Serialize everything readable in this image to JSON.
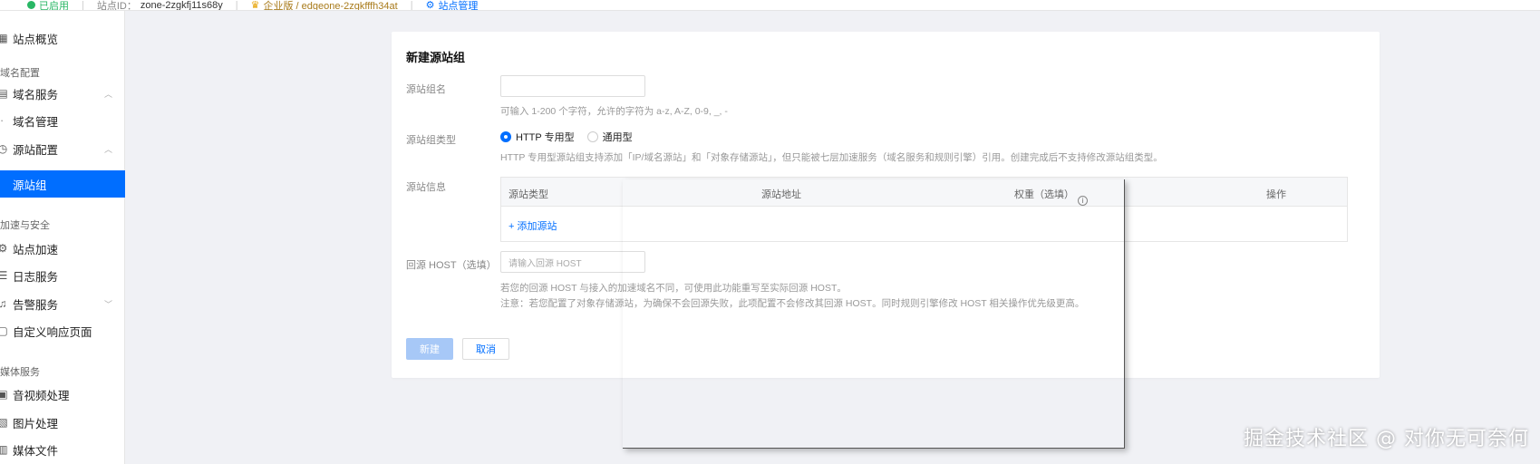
{
  "topbar": {
    "status": "已启用",
    "site_id_label": "站点ID：",
    "site_id": "zone-2zgkfj11s68y",
    "plan": "企业版 / edgeone-2zgkfffh34at",
    "manage": "站点管理",
    "colors": {
      "status": "#29b765",
      "link": "#006eff"
    }
  },
  "sidebar": {
    "overview": "站点概览",
    "group_config": "域名配置",
    "domain_service": "域名服务",
    "domain_manage": "域名管理",
    "origin_config": "源站配置",
    "origin_group": "源站组",
    "group_security": "加速与安全",
    "site_accel": "站点加速",
    "log_service": "日志服务",
    "alarm_service": "告警服务",
    "custom_page": "自定义响应页面",
    "group_media": "媒体服务",
    "av_process": "音视频处理",
    "image_process": "图片处理",
    "media_files": "媒体文件",
    "accent": "#006eff"
  },
  "form": {
    "title": "新建源站组",
    "name_label": "源站组名",
    "name_value": "",
    "name_hint": "可输入 1-200 个字符，允许的字符为 a-z, A-Z, 0-9, _, -",
    "type_label": "源站组类型",
    "type_options": [
      "HTTP 专用型",
      "通用型"
    ],
    "type_selected": "HTTP 专用型",
    "type_hint": "HTTP 专用型源站组支持添加「IP/域名源站」和「对象存储源站」，但只能被七层加速服务（域名服务和规则引擎）引用。创建完成后不支持修改源站组类型。",
    "origin_info_label": "源站信息",
    "table_headers": [
      "源站类型",
      "源站地址",
      "权重（选填）",
      "操作"
    ],
    "add_origin": "+ 添加源站",
    "host_label": "回源 HOST（选填）",
    "host_placeholder": "请输入回源 HOST",
    "host_hint_1": "若您的回源 HOST 与接入的加速域名不同，可使用此功能重写至实际回源 HOST。",
    "host_hint_2": "注意：若您配置了对象存储源站，为确保不会回源失败，此项配置不会修改其回源 HOST。同时规则引擎修改 HOST 相关操作优先级更高。",
    "create_button": "新建",
    "cancel_button": "取消"
  },
  "watermark": "掘金技术社区 @ 对你无可奈何"
}
